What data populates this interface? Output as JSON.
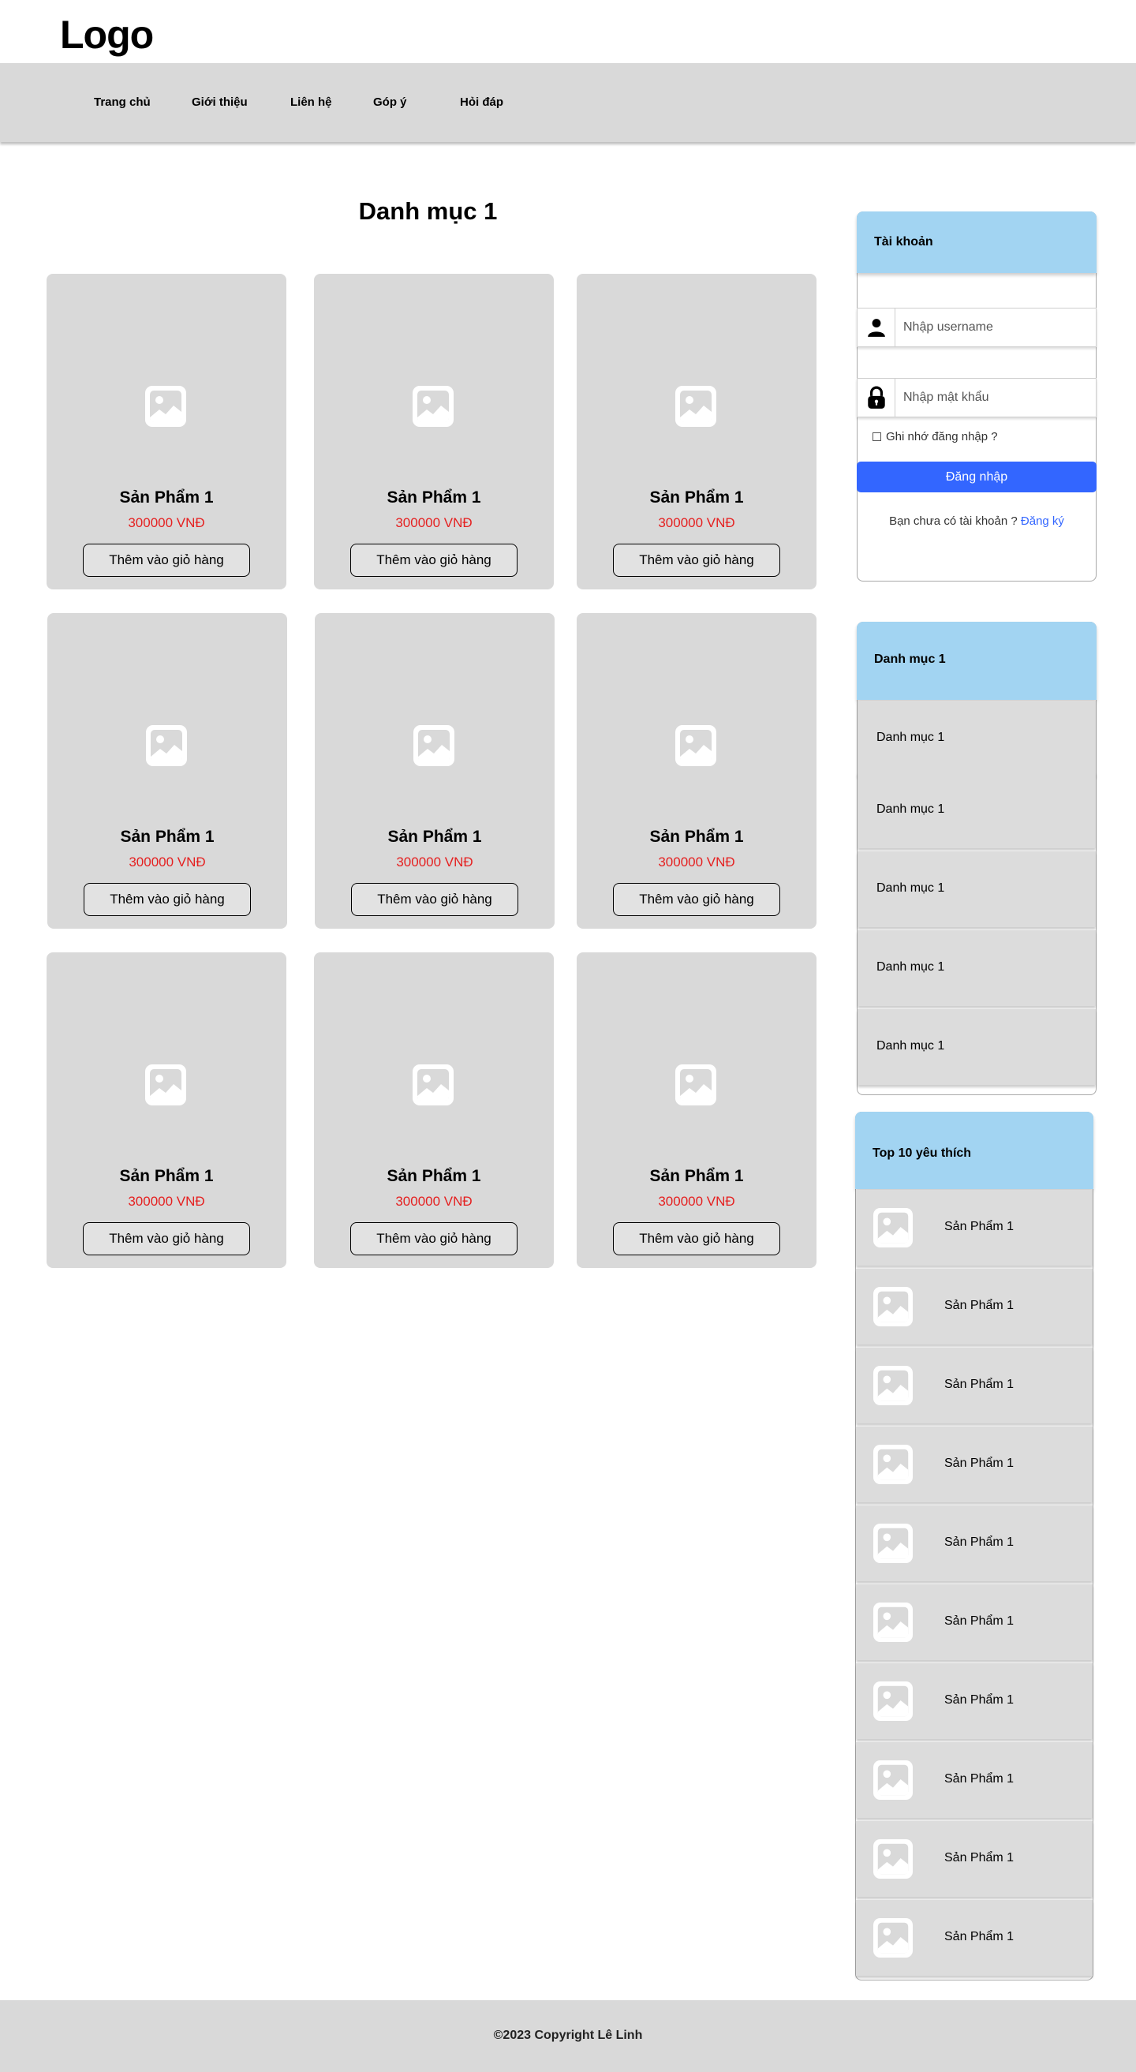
{
  "header": {
    "logo": "Logo",
    "nav": [
      "Trang chủ",
      "Giới thiệu",
      "Liên hệ",
      "Góp ý",
      "Hỏi đáp"
    ]
  },
  "main": {
    "title": "Danh mục 1",
    "products": [
      {
        "name": "Sản Phẩm 1",
        "price": "300000 VNĐ",
        "button": "Thêm vào giỏ hàng",
        "image_icon": "image-icon"
      },
      {
        "name": "Sản Phẩm 1",
        "price": "300000 VNĐ",
        "button": "Thêm vào giỏ hàng",
        "image_icon": "image-icon"
      },
      {
        "name": "Sản Phẩm 1",
        "price": "300000 VNĐ",
        "button": "Thêm vào giỏ hàng",
        "image_icon": "image-icon"
      },
      {
        "name": "Sản Phẩm 1",
        "price": "300000 VNĐ",
        "button": "Thêm vào giỏ hàng",
        "image_icon": "image-icon"
      },
      {
        "name": "Sản Phẩm 1",
        "price": "300000 VNĐ",
        "button": "Thêm vào giỏ hàng",
        "image_icon": "image-icon"
      },
      {
        "name": "Sản Phẩm 1",
        "price": "300000 VNĐ",
        "button": "Thêm vào giỏ hàng",
        "image_icon": "image-icon"
      },
      {
        "name": "Sản Phẩm 1",
        "price": "300000 VNĐ",
        "button": "Thêm vào giỏ hàng",
        "image_icon": "image-icon"
      },
      {
        "name": "Sản Phẩm 1",
        "price": "300000 VNĐ",
        "button": "Thêm vào giỏ hàng",
        "image_icon": "image-icon"
      },
      {
        "name": "Sản Phẩm 1",
        "price": "300000 VNĐ",
        "button": "Thêm vào giỏ hàng",
        "image_icon": "image-icon"
      }
    ]
  },
  "sidebar": {
    "account": {
      "title": "Tài khoản",
      "username_placeholder": "Nhập username",
      "username_icon": "user-icon",
      "password_placeholder": "Nhập mật khẩu",
      "password_icon": "lock-icon",
      "remember": "Ghi nhớ đăng nhập ?",
      "login_button": "Đăng nhập",
      "register_prompt": "Bạn chưa có tài khoản ?",
      "register_link": "Đăng ký"
    },
    "categories": {
      "title": "Danh mục 1",
      "items": [
        "Danh mục 1",
        "Danh mục 1",
        "Danh mục 1",
        "Danh mục 1",
        "Danh mục 1"
      ]
    },
    "top": {
      "title": "Top 10 yêu thích",
      "items": [
        "Sản Phẩm 1",
        "Sản Phẩm 1",
        "Sản Phẩm 1",
        "Sản Phẩm 1",
        "Sản Phẩm 1",
        "Sản Phẩm 1",
        "Sản Phẩm 1",
        "Sản Phẩm 1",
        "Sản Phẩm 1",
        "Sản Phẩm 1"
      ]
    }
  },
  "footer": {
    "copyright": "©2023 Copyright  Lê Linh"
  },
  "colors": {
    "accent_blue": "#3366ff",
    "panel_header": "#a2d4f2",
    "price_red": "#e52020",
    "card_bg": "#d9d9d9"
  }
}
